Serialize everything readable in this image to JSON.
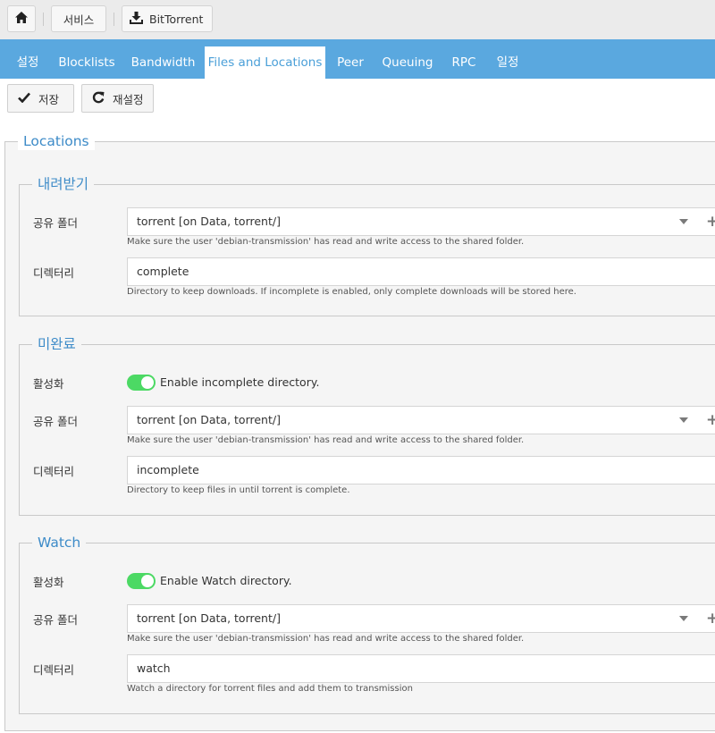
{
  "breadcrumb": {
    "home": "home-icon",
    "service": "서비스",
    "app": "BitTorrent",
    "app_icon": "download-tray-icon"
  },
  "tabs": [
    {
      "label": "설정",
      "active": false
    },
    {
      "label": "Blocklists",
      "active": false
    },
    {
      "label": "Bandwidth",
      "active": false
    },
    {
      "label": "Files and Locations",
      "active": true
    },
    {
      "label": "Peer",
      "active": false
    },
    {
      "label": "Queuing",
      "active": false
    },
    {
      "label": "RPC",
      "active": false
    },
    {
      "label": "일정",
      "active": false
    }
  ],
  "toolbar": {
    "save_label": "저장",
    "save_icon": "check-icon",
    "reset_label": "재설정",
    "reset_icon": "refresh-icon"
  },
  "locations": {
    "legend": "Locations",
    "download": {
      "legend": "내려받기",
      "shared_folder_label": "공유 폴더",
      "shared_folder_value": "torrent [on Data, torrent/]",
      "shared_folder_help": "Make sure the user 'debian-transmission' has read and write access to the shared folder.",
      "directory_label": "디렉터리",
      "directory_value": "complete",
      "directory_help": "Directory to keep downloads. If incomplete is enabled, only complete downloads will be stored here."
    },
    "incomplete": {
      "legend": "미완료",
      "enable_label": "활성화",
      "enable_text": "Enable incomplete directory.",
      "enabled": true,
      "shared_folder_label": "공유 폴더",
      "shared_folder_value": "torrent [on Data, torrent/]",
      "shared_folder_help": "Make sure the user 'debian-transmission' has read and write access to the shared folder.",
      "directory_label": "디렉터리",
      "directory_value": "incomplete",
      "directory_help": "Directory to keep files in until torrent is complete."
    },
    "watch": {
      "legend": "Watch",
      "enable_label": "활성화",
      "enable_text": "Enable Watch directory.",
      "enabled": true,
      "shared_folder_label": "공유 폴더",
      "shared_folder_value": "torrent [on Data, torrent/]",
      "shared_folder_help": "Make sure the user 'debian-transmission' has read and write access to the shared folder.",
      "directory_label": "디렉터리",
      "directory_value": "watch",
      "directory_help": "Watch a directory for torrent files and add them to transmission"
    }
  },
  "colors": {
    "tab_bar": "#5aa8df",
    "legend": "#3d8bc8",
    "toggle_on": "#4cd964"
  }
}
